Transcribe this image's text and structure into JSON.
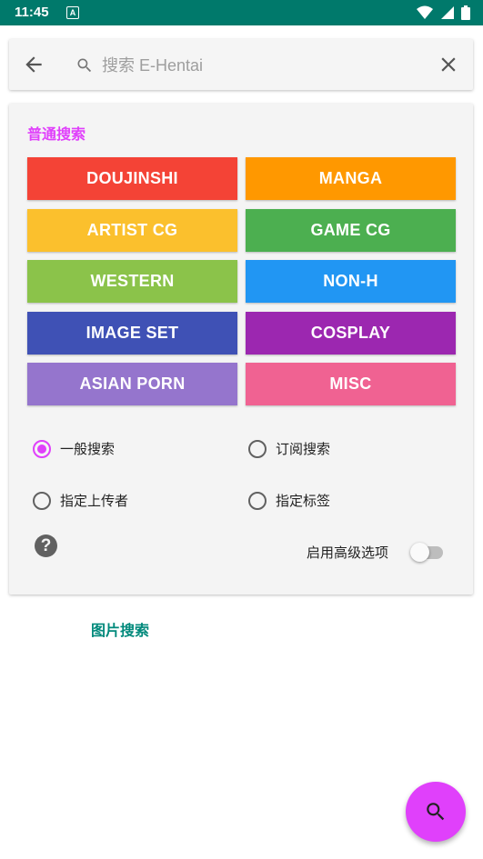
{
  "status_bar": {
    "time": "11:45",
    "notification_icon": "A",
    "icons": [
      "wifi-icon",
      "signal-icon",
      "battery-icon"
    ]
  },
  "search": {
    "placeholder": "搜索 E-Hentai",
    "value": "",
    "back_icon": "arrow-left-icon",
    "search_icon": "search-icon",
    "clear_icon": "close-icon"
  },
  "normal_search": {
    "title": "普通搜索",
    "categories": [
      {
        "label": "DOUJINSHI",
        "color": "#f44336"
      },
      {
        "label": "MANGA",
        "color": "#ff9800"
      },
      {
        "label": "ARTIST CG",
        "color": "#fbc02d"
      },
      {
        "label": "GAME CG",
        "color": "#4caf50"
      },
      {
        "label": "WESTERN",
        "color": "#8bc34a"
      },
      {
        "label": "NON-H",
        "color": "#2196f3"
      },
      {
        "label": "IMAGE SET",
        "color": "#3f51b5"
      },
      {
        "label": "COSPLAY",
        "color": "#9c27b0"
      },
      {
        "label": "ASIAN PORN",
        "color": "#9575cd"
      },
      {
        "label": "MISC",
        "color": "#f06292"
      }
    ],
    "modes": [
      {
        "label": "一般搜索",
        "checked": true
      },
      {
        "label": "订阅搜索",
        "checked": false
      },
      {
        "label": "指定上传者",
        "checked": false
      },
      {
        "label": "指定标签",
        "checked": false
      }
    ],
    "help_icon": "help-icon",
    "advanced_label": "启用高级选项",
    "advanced_enabled": false
  },
  "image_search": {
    "label": "图片搜索"
  },
  "fab": {
    "icon": "search-icon"
  },
  "colors": {
    "accent": "#e040fb",
    "status_bar": "#00796b",
    "link": "#00897b"
  }
}
